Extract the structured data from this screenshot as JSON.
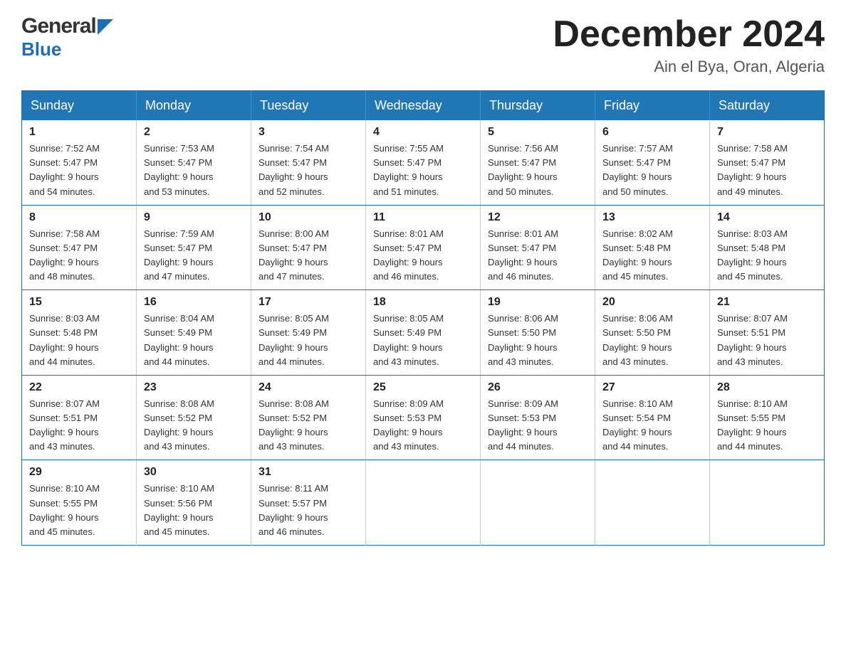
{
  "header": {
    "logo_general": "General",
    "logo_blue": "Blue",
    "month_year": "December 2024",
    "location": "Ain el Bya, Oran, Algeria"
  },
  "days_of_week": [
    "Sunday",
    "Monday",
    "Tuesday",
    "Wednesday",
    "Thursday",
    "Friday",
    "Saturday"
  ],
  "weeks": [
    [
      {
        "day": "1",
        "sunrise": "7:52 AM",
        "sunset": "5:47 PM",
        "daylight": "9 hours and 54 minutes."
      },
      {
        "day": "2",
        "sunrise": "7:53 AM",
        "sunset": "5:47 PM",
        "daylight": "9 hours and 53 minutes."
      },
      {
        "day": "3",
        "sunrise": "7:54 AM",
        "sunset": "5:47 PM",
        "daylight": "9 hours and 52 minutes."
      },
      {
        "day": "4",
        "sunrise": "7:55 AM",
        "sunset": "5:47 PM",
        "daylight": "9 hours and 51 minutes."
      },
      {
        "day": "5",
        "sunrise": "7:56 AM",
        "sunset": "5:47 PM",
        "daylight": "9 hours and 50 minutes."
      },
      {
        "day": "6",
        "sunrise": "7:57 AM",
        "sunset": "5:47 PM",
        "daylight": "9 hours and 50 minutes."
      },
      {
        "day": "7",
        "sunrise": "7:58 AM",
        "sunset": "5:47 PM",
        "daylight": "9 hours and 49 minutes."
      }
    ],
    [
      {
        "day": "8",
        "sunrise": "7:58 AM",
        "sunset": "5:47 PM",
        "daylight": "9 hours and 48 minutes."
      },
      {
        "day": "9",
        "sunrise": "7:59 AM",
        "sunset": "5:47 PM",
        "daylight": "9 hours and 47 minutes."
      },
      {
        "day": "10",
        "sunrise": "8:00 AM",
        "sunset": "5:47 PM",
        "daylight": "9 hours and 47 minutes."
      },
      {
        "day": "11",
        "sunrise": "8:01 AM",
        "sunset": "5:47 PM",
        "daylight": "9 hours and 46 minutes."
      },
      {
        "day": "12",
        "sunrise": "8:01 AM",
        "sunset": "5:47 PM",
        "daylight": "9 hours and 46 minutes."
      },
      {
        "day": "13",
        "sunrise": "8:02 AM",
        "sunset": "5:48 PM",
        "daylight": "9 hours and 45 minutes."
      },
      {
        "day": "14",
        "sunrise": "8:03 AM",
        "sunset": "5:48 PM",
        "daylight": "9 hours and 45 minutes."
      }
    ],
    [
      {
        "day": "15",
        "sunrise": "8:03 AM",
        "sunset": "5:48 PM",
        "daylight": "9 hours and 44 minutes."
      },
      {
        "day": "16",
        "sunrise": "8:04 AM",
        "sunset": "5:49 PM",
        "daylight": "9 hours and 44 minutes."
      },
      {
        "day": "17",
        "sunrise": "8:05 AM",
        "sunset": "5:49 PM",
        "daylight": "9 hours and 44 minutes."
      },
      {
        "day": "18",
        "sunrise": "8:05 AM",
        "sunset": "5:49 PM",
        "daylight": "9 hours and 43 minutes."
      },
      {
        "day": "19",
        "sunrise": "8:06 AM",
        "sunset": "5:50 PM",
        "daylight": "9 hours and 43 minutes."
      },
      {
        "day": "20",
        "sunrise": "8:06 AM",
        "sunset": "5:50 PM",
        "daylight": "9 hours and 43 minutes."
      },
      {
        "day": "21",
        "sunrise": "8:07 AM",
        "sunset": "5:51 PM",
        "daylight": "9 hours and 43 minutes."
      }
    ],
    [
      {
        "day": "22",
        "sunrise": "8:07 AM",
        "sunset": "5:51 PM",
        "daylight": "9 hours and 43 minutes."
      },
      {
        "day": "23",
        "sunrise": "8:08 AM",
        "sunset": "5:52 PM",
        "daylight": "9 hours and 43 minutes."
      },
      {
        "day": "24",
        "sunrise": "8:08 AM",
        "sunset": "5:52 PM",
        "daylight": "9 hours and 43 minutes."
      },
      {
        "day": "25",
        "sunrise": "8:09 AM",
        "sunset": "5:53 PM",
        "daylight": "9 hours and 43 minutes."
      },
      {
        "day": "26",
        "sunrise": "8:09 AM",
        "sunset": "5:53 PM",
        "daylight": "9 hours and 44 minutes."
      },
      {
        "day": "27",
        "sunrise": "8:10 AM",
        "sunset": "5:54 PM",
        "daylight": "9 hours and 44 minutes."
      },
      {
        "day": "28",
        "sunrise": "8:10 AM",
        "sunset": "5:55 PM",
        "daylight": "9 hours and 44 minutes."
      }
    ],
    [
      {
        "day": "29",
        "sunrise": "8:10 AM",
        "sunset": "5:55 PM",
        "daylight": "9 hours and 45 minutes."
      },
      {
        "day": "30",
        "sunrise": "8:10 AM",
        "sunset": "5:56 PM",
        "daylight": "9 hours and 45 minutes."
      },
      {
        "day": "31",
        "sunrise": "8:11 AM",
        "sunset": "5:57 PM",
        "daylight": "9 hours and 46 minutes."
      },
      null,
      null,
      null,
      null
    ]
  ],
  "labels": {
    "sunrise": "Sunrise:",
    "sunset": "Sunset:",
    "daylight": "Daylight:"
  }
}
